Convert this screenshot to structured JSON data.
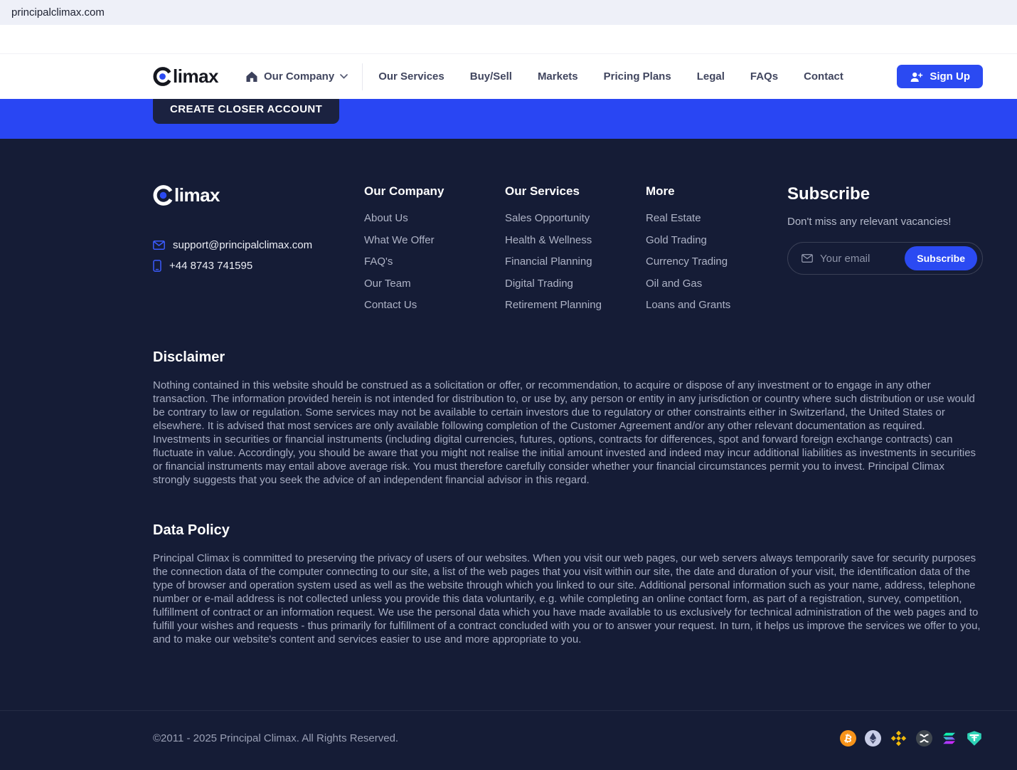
{
  "browser": {
    "url": "principalclimax.com"
  },
  "nav": {
    "brand_rest": "limax",
    "company_item": "Our Company",
    "links": [
      "Our Services",
      "Buy/Sell",
      "Markets",
      "Pricing Plans",
      "Legal",
      "FAQs",
      "Contact"
    ],
    "signup_label": "Sign Up"
  },
  "hero": {
    "cta_label": "CREATE CLOSER ACCOUNT"
  },
  "footer": {
    "brand_rest": "limax",
    "email": "support@principalclimax.com",
    "phone": "+44 8743 741595",
    "columns": [
      {
        "title": "Our Company",
        "items": [
          "About Us",
          "What We Offer",
          "FAQ's",
          "Our Team",
          "Contact Us"
        ]
      },
      {
        "title": "Our Services",
        "items": [
          "Sales Opportunity",
          "Health & Wellness",
          "Financial Planning",
          "Digital Trading",
          "Retirement Planning"
        ]
      },
      {
        "title": "More",
        "items": [
          "Real Estate",
          "Gold Trading",
          "Currency Trading",
          "Oil and Gas",
          "Loans and Grants"
        ]
      }
    ],
    "subscribe": {
      "title": "Subscribe",
      "subtitle": "Don't miss any relevant vacancies!",
      "placeholder": "Your email",
      "button_label": "Subscribe"
    },
    "disclaimer": {
      "title": "Disclaimer",
      "body": "Nothing contained in this website should be construed as a solicitation or offer, or recommendation, to acquire or dispose of any investment or to engage in any other transaction. The information provided herein is not intended for distribution to, or use by, any person or entity in any jurisdiction or country where such distribution or use would be contrary to law or regulation. Some services may not be available to certain investors due to regulatory or other constraints either in Switzerland, the United States or elsewhere. It is advised that most services are only available following completion of the Customer Agreement and/or any other relevant documentation as required. Investments in securities or financial instruments (including digital currencies, futures, options, contracts for differences, spot and forward foreign exchange contracts) can fluctuate in value. Accordingly, you should be aware that you might not realise the initial amount invested and indeed may incur additional liabilities as investments in securities or financial instruments may entail above average risk. You must therefore carefully consider whether your financial circumstances permit you to invest. Principal Climax strongly suggests that you seek the advice of an independent financial advisor in this regard."
    },
    "data_policy": {
      "title": "Data Policy",
      "body": "Principal Climax is committed to preserving the privacy of users of our websites. When you visit our web pages, our web servers always temporarily save for security purposes the connection data of the computer connecting to our site, a list of the web pages that you visit within our site, the date and duration of your visit, the identification data of the type of browser and operation system used as well as the website through which you linked to our site. Additional personal information such as your name, address, telephone number or e-mail address is not collected unless you provide this data voluntarily, e.g. while completing an online contact form, as part of a registration, survey, competition, fulfillment of contract or an information request. We use the personal data which you have made available to us exclusively for technical administration of the web pages and to fulfill your wishes and requests - thus primarily for fulfillment of a contract concluded with you or to answer your request. In turn, it helps us improve the services we offer to you, and to make our website's content and services easier to use and more appropriate to you."
    },
    "copyright": "©2011 - 2025 Principal Climax. All Rights Reserved.",
    "crypto_icons": [
      "bitcoin",
      "ethereum",
      "binance",
      "xrp",
      "solana",
      "tether"
    ]
  },
  "colors": {
    "accent_blue": "#2b4af2",
    "band_blue": "#2946f3",
    "footer_bg": "#151c36",
    "cta_dark": "#1b2240",
    "bitcoin_orange": "#f7931a",
    "ethereum_lavender": "#c9cee8",
    "binance_yellow": "#f0b90b",
    "xrp_gray": "#40474f",
    "tether_teal": "#2ed3b7"
  }
}
